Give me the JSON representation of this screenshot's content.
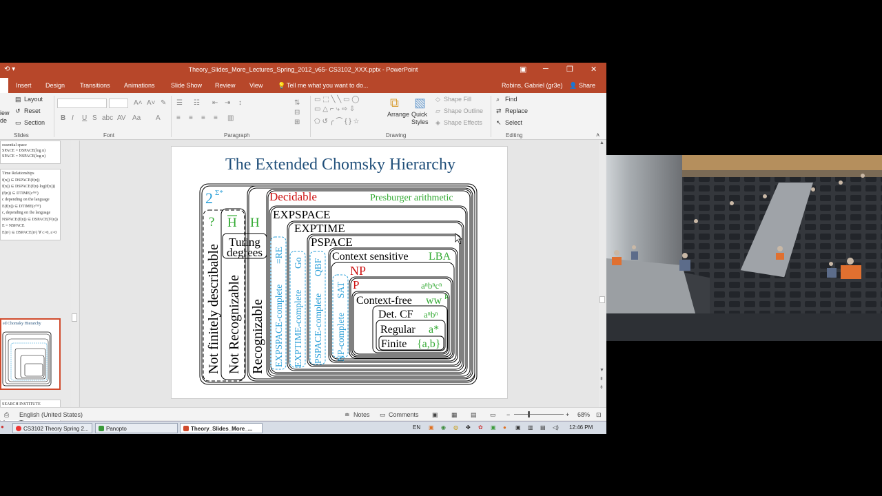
{
  "window": {
    "title": "Theory_Slides_More_Lectures_Spring_2012_v65- CS3102_XXX.pptx - PowerPoint",
    "minimize_glyph": "─",
    "restore_glyph": "❐",
    "close_glyph": "✕"
  },
  "tabs": [
    "Insert",
    "Design",
    "Transitions",
    "Animations",
    "Slide Show",
    "Review",
    "View"
  ],
  "tell_me": "Tell me what you want to do...",
  "user": "Robins, Gabriel (gr3e)",
  "share": "Share",
  "ribbon": {
    "slides_group": {
      "new_slide_fragment": "iew",
      "new_slide_fragment2": "de",
      "layout": "Layout",
      "reset": "Reset",
      "section": "Section",
      "label": "Slides"
    },
    "font_label": "Font",
    "paragraph_label": "Paragraph",
    "drawing": {
      "arrange": "Arrange",
      "quick_styles": "Quick Styles",
      "shape_fill": "Shape Fill",
      "shape_outline": "Shape Outline",
      "shape_effects": "Shape Effects",
      "label": "Drawing"
    },
    "editing": {
      "find": "Find",
      "replace": "Replace",
      "select": "Select",
      "label": "Editing"
    }
  },
  "thumbnails": [
    {
      "lines": [
        "ossential space",
        "SPACE = DSPACE(log n)",
        "SPACE = NSPACE(log n)"
      ]
    },
    {
      "lines": [
        "Time Relationships",
        "f(n)) ⊆ DSPACE(f(n))",
        "f(n)) ⊆ DSPACE(f(n)·log(f(n)))",
        "(f(n)) ⊆ DTIME(cᶠ⁽ⁿ⁾)",
        "c depending on the language",
        "E(f(n)) ⊆ DTIME(cᶠ⁽ⁿ⁾)",
        "c, depending on the language",
        "NSPACE(f(n)) ⊆ DSPACE(f²(n))",
        "E = NSPACE",
        "E(nᶜ) ⊆ DSPACE(nᶜ) ∀ c>0, ε>0"
      ]
    },
    {
      "lines": [
        "ed Chomsky Hierarchy"
      ]
    },
    {
      "lines": [
        "SEARCH INSTITUTE"
      ]
    }
  ],
  "slide": {
    "title": "The Extended Chomsky Hierarchy",
    "labels": {
      "powerset": "2",
      "powerset_sup": "Σ*",
      "question": "?",
      "h_bar": "H",
      "h": "H",
      "turing1": "Turing",
      "turing2": "degrees",
      "not_finitely": "Not finitely describable",
      "not_recognizable": "Not Recognizable",
      "recognizable": "Recognizable",
      "decidable": "Decidable",
      "presburger": "Presburger arithmetic",
      "expspace": "EXPSPACE",
      "exptime": "EXPTIME",
      "pspace": "PSPACE",
      "csl": "Context sensitive",
      "lba": "LBA",
      "np": "NP",
      "p": "P",
      "anbncn": "aⁿbⁿcⁿ",
      "cf": "Context-free",
      "wwr": "ww",
      "wwr_sup": "R",
      "dcf": "Det. CF",
      "anbn": "aⁿbⁿ",
      "regular": "Regular",
      "astar": "a*",
      "finite": "Finite",
      "ab": "{a,b}",
      "expspace_complete": "EXPSPACE-complete",
      "expspace_complete_ex": "=RE",
      "exptime_complete": "EXPTIME-complete",
      "exptime_complete_ex": "Go",
      "pspace_complete": "PSPACE-complete",
      "pspace_complete_ex": "QBF",
      "np_complete": "NP-complete",
      "np_complete_ex": "SAT"
    }
  },
  "status": {
    "language": "English (United States)",
    "notes": "Notes",
    "comments": "Comments",
    "zoom": "68%"
  },
  "taskbar": {
    "items": [
      "CS3102 Theory Spring 2...",
      "Panopto",
      "Theory_Slides_More_..."
    ],
    "lang": "EN",
    "time": "12:46 PM"
  },
  "colors": {
    "title_blue": "#1f4e79",
    "red": "#cc1111",
    "green": "#33aa33",
    "cyan": "#2a9fd8",
    "ppt_orange": "#b7472a"
  }
}
